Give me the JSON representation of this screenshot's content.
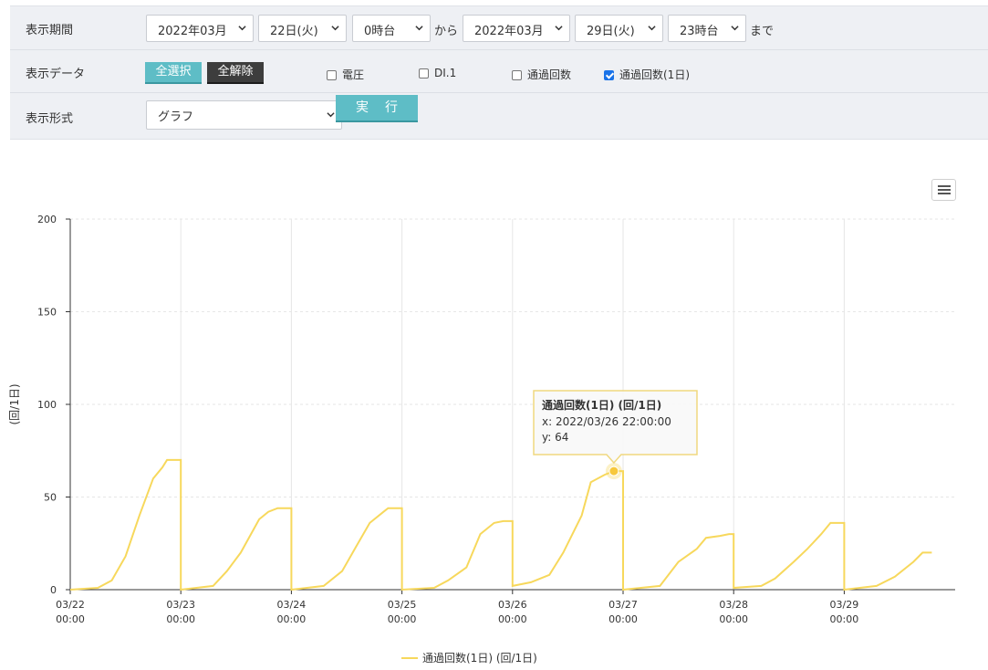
{
  "filter": {
    "period_label": "表示期間",
    "start_month": "2022年03月",
    "start_day": "22日(火)",
    "start_hour": "0時台",
    "from_text": "から",
    "end_month": "2022年03月",
    "end_day": "29日(火)",
    "end_hour": "23時台",
    "until_text": "まで",
    "data_label": "表示データ",
    "select_all": "全選択",
    "clear_all": "全解除",
    "checkboxes": [
      {
        "label": "電圧",
        "checked": false
      },
      {
        "label": "DI.1",
        "checked": false
      },
      {
        "label": "通過回数",
        "checked": false
      },
      {
        "label": "通過回数(1日)",
        "checked": true
      }
    ],
    "format_label": "表示形式",
    "format_value": "グラフ",
    "run_button": "実行"
  },
  "chart_data": {
    "type": "line",
    "ylabel": "(回/1日)",
    "ylim": [
      0,
      200
    ],
    "yticks": [
      0,
      50,
      100,
      150,
      200
    ],
    "xticks": [
      "03/22 00:00",
      "03/23 00:00",
      "03/24 00:00",
      "03/25 00:00",
      "03/26 00:00",
      "03/27 00:00",
      "03/28 00:00",
      "03/29 00:00"
    ],
    "grid": true,
    "legend_position": "bottom-center",
    "series": [
      {
        "name": "通過回数(1日) (回/1日)",
        "color": "#f7d85c",
        "points": [
          [
            "03/22 00:00",
            0
          ],
          [
            "03/22 06:00",
            1
          ],
          [
            "03/22 09:00",
            5
          ],
          [
            "03/22 12:00",
            18
          ],
          [
            "03/22 15:00",
            40
          ],
          [
            "03/22 18:00",
            60
          ],
          [
            "03/22 20:00",
            66
          ],
          [
            "03/22 21:00",
            70
          ],
          [
            "03/22 23:00",
            70
          ],
          [
            "03/23 00:00",
            0
          ],
          [
            "03/23 07:00",
            2
          ],
          [
            "03/23 10:00",
            10
          ],
          [
            "03/23 13:00",
            20
          ],
          [
            "03/23 17:00",
            38
          ],
          [
            "03/23 19:00",
            42
          ],
          [
            "03/23 21:00",
            44
          ],
          [
            "03/23 23:00",
            44
          ],
          [
            "03/24 00:00",
            0
          ],
          [
            "03/24 07:00",
            2
          ],
          [
            "03/24 11:00",
            10
          ],
          [
            "03/24 14:00",
            23
          ],
          [
            "03/24 17:00",
            36
          ],
          [
            "03/24 20:00",
            42
          ],
          [
            "03/24 21:00",
            44
          ],
          [
            "03/24 23:00",
            44
          ],
          [
            "03/25 00:00",
            0
          ],
          [
            "03/25 07:00",
            1
          ],
          [
            "03/25 10:00",
            5
          ],
          [
            "03/25 14:00",
            12
          ],
          [
            "03/25 17:00",
            30
          ],
          [
            "03/25 20:00",
            36
          ],
          [
            "03/25 22:00",
            37
          ],
          [
            "03/25 23:00",
            37
          ],
          [
            "03/26 00:00",
            2
          ],
          [
            "03/26 04:00",
            4
          ],
          [
            "03/26 08:00",
            8
          ],
          [
            "03/26 11:00",
            20
          ],
          [
            "03/26 15:00",
            40
          ],
          [
            "03/26 17:00",
            58
          ],
          [
            "03/26 20:00",
            62
          ],
          [
            "03/26 22:00",
            64
          ],
          [
            "03/26 23:00",
            64
          ],
          [
            "03/27 00:00",
            0
          ],
          [
            "03/27 08:00",
            2
          ],
          [
            "03/27 12:00",
            15
          ],
          [
            "03/27 16:00",
            22
          ],
          [
            "03/27 18:00",
            28
          ],
          [
            "03/27 21:00",
            29
          ],
          [
            "03/27 23:00",
            30
          ],
          [
            "03/28 00:00",
            1
          ],
          [
            "03/28 06:00",
            2
          ],
          [
            "03/28 09:00",
            6
          ],
          [
            "03/28 13:00",
            15
          ],
          [
            "03/28 16:00",
            22
          ],
          [
            "03/28 19:00",
            30
          ],
          [
            "03/28 21:00",
            36
          ],
          [
            "03/28 23:00",
            36
          ],
          [
            "03/29 00:00",
            0
          ],
          [
            "03/29 07:00",
            2
          ],
          [
            "03/29 11:00",
            7
          ],
          [
            "03/29 15:00",
            15
          ],
          [
            "03/29 17:00",
            20
          ],
          [
            "03/29 19:00",
            20
          ]
        ]
      }
    ],
    "tooltip": {
      "title": "通過回数(1日) (回/1日)",
      "x_line": "x: 2022/03/26 22:00:00",
      "y_line": "y: 64",
      "x": "03/26 22:00",
      "y": 64
    }
  }
}
